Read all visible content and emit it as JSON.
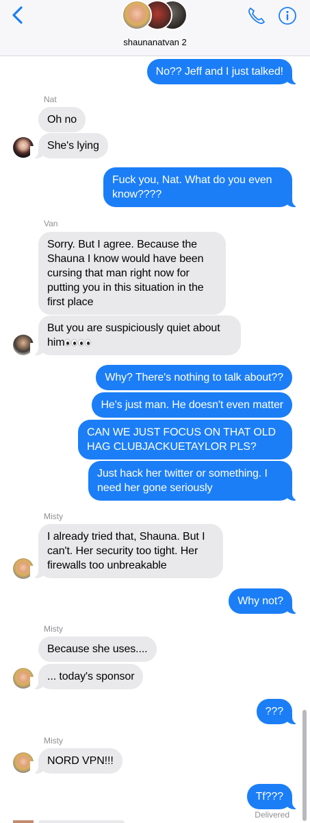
{
  "header": {
    "group_name": "shaunanatvan 2",
    "icons": [
      "back-chevron-icon",
      "phone-icon",
      "info-icon"
    ],
    "accent_color": "#1b7ef7"
  },
  "messages": [
    {
      "side": "out",
      "text": "No?? Jeff and I just talked!"
    },
    {
      "sender": "Nat"
    },
    {
      "side": "in",
      "text": "Oh no"
    },
    {
      "side": "in",
      "text": "She's lying"
    },
    {
      "side": "out",
      "text": "Fuck you, Nat. What do you even know????"
    },
    {
      "sender": "Van"
    },
    {
      "side": "in",
      "text": "Sorry. But I agree. Because the Shauna I know would have been cursing that man right now for putting you in this situation in the first place"
    },
    {
      "side": "in",
      "text": "But you are suspiciously quiet about him"
    },
    {
      "side": "out",
      "text": "Why? There's nothing to talk about??"
    },
    {
      "side": "out",
      "text": "He's just man. He doesn't even matter"
    },
    {
      "side": "out",
      "text": "CAN WE JUST FOCUS ON THAT OLD HAG CLUBJACKUETAYLOR PLS?"
    },
    {
      "side": "out",
      "text": "Just hack her twitter or something. I need her gone seriously"
    },
    {
      "sender": "Misty"
    },
    {
      "side": "in",
      "text": "I already tried that, Shauna. But I can't. Her security too tight. Her firewalls too unbreakable"
    },
    {
      "side": "out",
      "text": "Why not?"
    },
    {
      "sender": "Misty"
    },
    {
      "side": "in",
      "text": "Because she uses...."
    },
    {
      "side": "in",
      "text": "... today's sponsor"
    },
    {
      "side": "out",
      "text": "???"
    },
    {
      "sender": "Misty"
    },
    {
      "side": "in",
      "text": "NORD VPN!!!"
    },
    {
      "side": "out",
      "text": "Tf???"
    }
  ],
  "status": {
    "delivered": "Delivered"
  },
  "colors": {
    "outgoing": "#1b7ef7",
    "incoming": "#e9e9eb",
    "meta": "#8e8e93"
  }
}
